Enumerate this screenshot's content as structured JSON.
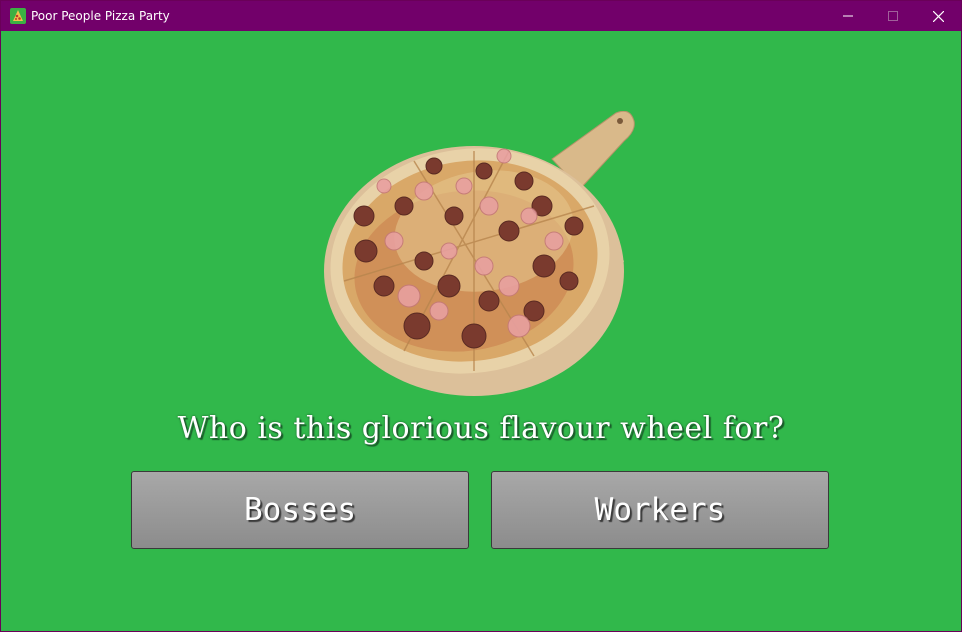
{
  "window": {
    "title": "Poor People Pizza Party",
    "icons": [
      "pizza-app-icon",
      "minimize-icon",
      "maximize-icon",
      "close-icon"
    ]
  },
  "game": {
    "image": "pizza-on-peel",
    "question": "Who is this glorious flavour wheel for?",
    "choices": [
      {
        "label": "Bosses"
      },
      {
        "label": "Workers"
      }
    ]
  },
  "colors": {
    "titlebar": "#72006a",
    "background": "#31b84b",
    "button": "#9a9a9a"
  }
}
